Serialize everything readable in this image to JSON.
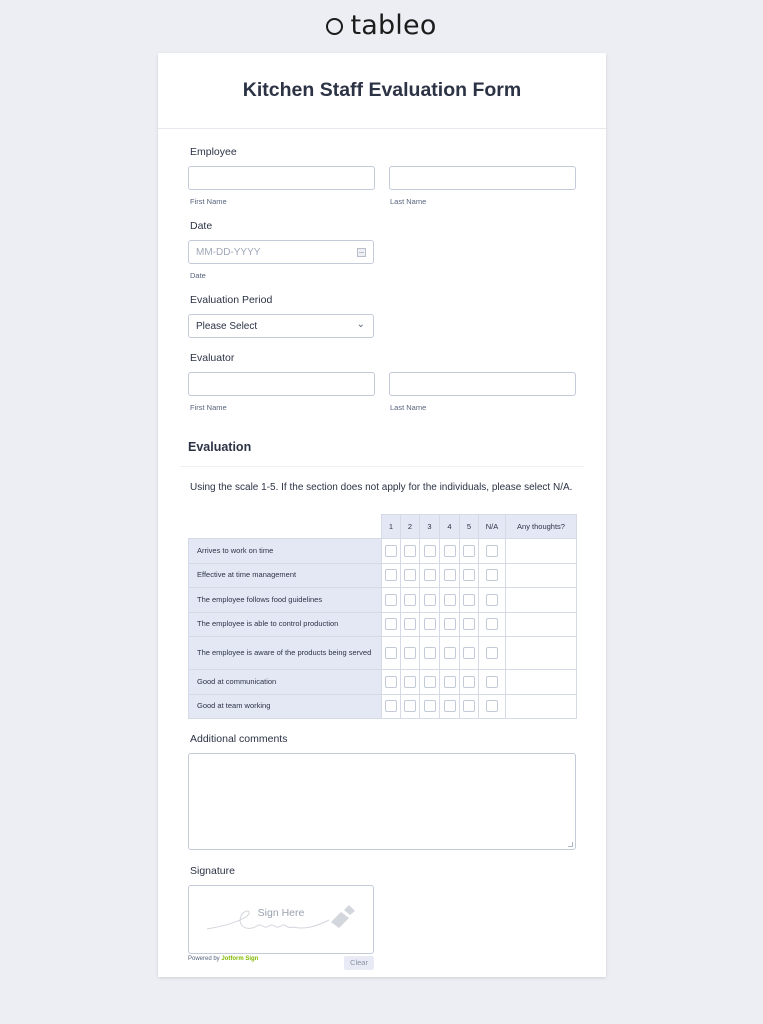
{
  "brand": {
    "logo_text": "tableo",
    "logo_icon": "ring-icon"
  },
  "form": {
    "title": "Kitchen Staff Evaluation Form",
    "employee": {
      "label": "Employee",
      "first_name_sublabel": "First Name",
      "last_name_sublabel": "Last Name",
      "first_name_value": "",
      "last_name_value": ""
    },
    "date": {
      "label": "Date",
      "placeholder": "MM-DD-YYYY",
      "sublabel": "Date",
      "icon": "calendar-icon"
    },
    "evaluation_period": {
      "label": "Evaluation Period",
      "selected": "Please Select",
      "icon": "chevron-down-icon"
    },
    "evaluator": {
      "label": "Evaluator",
      "first_name_sublabel": "First Name",
      "last_name_sublabel": "Last Name",
      "first_name_value": "",
      "last_name_value": ""
    },
    "evaluation": {
      "section_title": "Evaluation",
      "instructions": "Using the scale 1-5. If the section does not apply for the individuals, please select N/A.",
      "columns": [
        "1",
        "2",
        "3",
        "4",
        "5",
        "N/A",
        "Any thoughts?"
      ],
      "rows": [
        "Arrives to work on time",
        "Effective at time management",
        "The employee follows food guidelines",
        "The employee is able to control production",
        "The employee is aware of the products being served",
        "Good at communication",
        "Good at team working"
      ]
    },
    "additional_comments": {
      "label": "Additional comments",
      "value": ""
    },
    "signature": {
      "label": "Signature",
      "pad_hint": "Sign Here",
      "powered_by": "Powered by",
      "powered_brand": "Jotform Sign",
      "clear_label": "Clear"
    }
  },
  "colors": {
    "background": "#eceef3",
    "matrix_header": "#e4e8f5",
    "brand_green": "#7fb800",
    "text": "#2c3345"
  }
}
